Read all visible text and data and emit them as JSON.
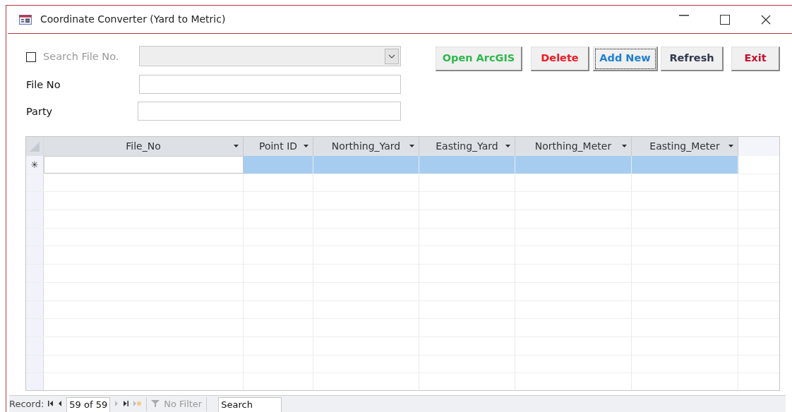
{
  "window": {
    "title": "Coordinate Converter (Yard to Metric)"
  },
  "search": {
    "label": "Search File No.",
    "checked": false,
    "disabled": true
  },
  "fields": [
    {
      "label": "File No"
    },
    {
      "label": "Party"
    }
  ],
  "buttons": [
    {
      "label": "Open ArcGIS",
      "color": "#2db84d",
      "focused": false
    },
    {
      "label": "Delete",
      "color": "#ee1c25",
      "focused": false
    },
    {
      "label": "Add New",
      "color": "#1e7fd1",
      "focused": true
    },
    {
      "label": "Refresh",
      "color": "#303850",
      "focused": false
    },
    {
      "label": "Exit",
      "color": "#c8102e",
      "focused": false
    }
  ],
  "table": {
    "columns": [
      {
        "label": "File_No",
        "active": true
      },
      {
        "label": "Point ID",
        "active": false
      },
      {
        "label": "Northing_Yard",
        "active": false
      },
      {
        "label": "Easting_Yard",
        "active": false
      },
      {
        "label": "Northing_Meter",
        "active": false
      },
      {
        "label": "Easting_Meter",
        "active": false
      }
    ],
    "new_row": {
      "marker": "✳",
      "selected": true
    }
  },
  "navigator": {
    "label": "Record:",
    "position": "59 of 59",
    "filter": "No Filter",
    "search": "Search"
  }
}
